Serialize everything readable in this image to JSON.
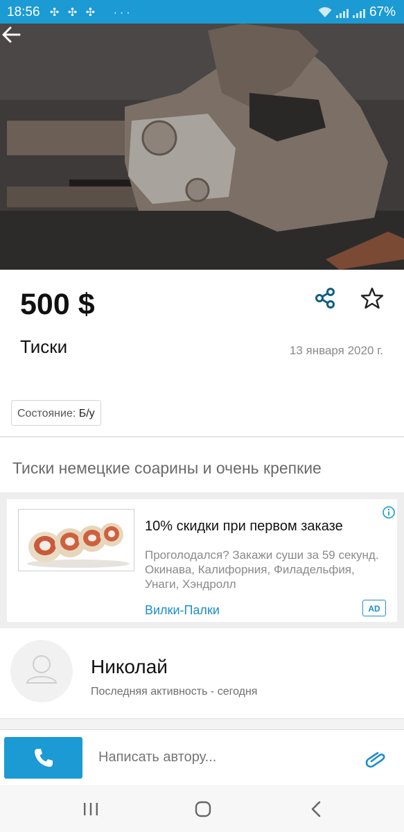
{
  "status_bar": {
    "time": "18:56",
    "notification_icons": "✣ ✣ ✣",
    "more": "···",
    "battery": "67%"
  },
  "gallery": {
    "image_description_icon": "vise-photo",
    "dots_total": 4,
    "active_dot": 4
  },
  "listing": {
    "price": "500 $",
    "title": "Тиски",
    "date": "13 января 2020 г.",
    "condition_label": "Состояние:",
    "condition_value": "Б/у",
    "description": "Тиски немецкие соарины и очень крепкие"
  },
  "ad": {
    "title": "10% скидки при первом заказе",
    "text": "Проголодался? Закажи суши за 59 секунд. Окинава, Калифорния, Филадельфия, Унаги, Хэндролл",
    "brand": "Вилки-Палки",
    "badge": "AD",
    "info_icon": "info-icon"
  },
  "seller": {
    "name": "Николай",
    "activity": "Последняя активность - сегодня"
  },
  "bottom_bar": {
    "message_placeholder": "Написать автору..."
  },
  "colors": {
    "accent": "#1b9ad3",
    "link": "#1b8ec9",
    "status_bar": "#1b9ad3"
  },
  "icons": {
    "back": "arrow-left-icon",
    "share": "share-icon",
    "favorite": "star-outline-icon",
    "call": "phone-icon",
    "attach": "paperclip-icon",
    "nav_recent": "recent-apps-icon",
    "nav_home": "home-icon",
    "nav_back": "nav-back-icon"
  }
}
